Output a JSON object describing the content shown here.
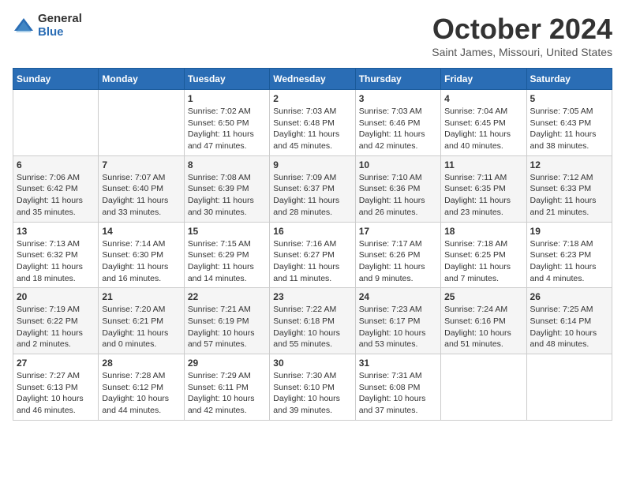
{
  "header": {
    "logo_general": "General",
    "logo_blue": "Blue",
    "month_title": "October 2024",
    "location": "Saint James, Missouri, United States"
  },
  "days_of_week": [
    "Sunday",
    "Monday",
    "Tuesday",
    "Wednesday",
    "Thursday",
    "Friday",
    "Saturday"
  ],
  "weeks": [
    [
      {
        "day": "",
        "sunrise": "",
        "sunset": "",
        "daylight": ""
      },
      {
        "day": "",
        "sunrise": "",
        "sunset": "",
        "daylight": ""
      },
      {
        "day": "1",
        "sunrise": "Sunrise: 7:02 AM",
        "sunset": "Sunset: 6:50 PM",
        "daylight": "Daylight: 11 hours and 47 minutes."
      },
      {
        "day": "2",
        "sunrise": "Sunrise: 7:03 AM",
        "sunset": "Sunset: 6:48 PM",
        "daylight": "Daylight: 11 hours and 45 minutes."
      },
      {
        "day": "3",
        "sunrise": "Sunrise: 7:03 AM",
        "sunset": "Sunset: 6:46 PM",
        "daylight": "Daylight: 11 hours and 42 minutes."
      },
      {
        "day": "4",
        "sunrise": "Sunrise: 7:04 AM",
        "sunset": "Sunset: 6:45 PM",
        "daylight": "Daylight: 11 hours and 40 minutes."
      },
      {
        "day": "5",
        "sunrise": "Sunrise: 7:05 AM",
        "sunset": "Sunset: 6:43 PM",
        "daylight": "Daylight: 11 hours and 38 minutes."
      }
    ],
    [
      {
        "day": "6",
        "sunrise": "Sunrise: 7:06 AM",
        "sunset": "Sunset: 6:42 PM",
        "daylight": "Daylight: 11 hours and 35 minutes."
      },
      {
        "day": "7",
        "sunrise": "Sunrise: 7:07 AM",
        "sunset": "Sunset: 6:40 PM",
        "daylight": "Daylight: 11 hours and 33 minutes."
      },
      {
        "day": "8",
        "sunrise": "Sunrise: 7:08 AM",
        "sunset": "Sunset: 6:39 PM",
        "daylight": "Daylight: 11 hours and 30 minutes."
      },
      {
        "day": "9",
        "sunrise": "Sunrise: 7:09 AM",
        "sunset": "Sunset: 6:37 PM",
        "daylight": "Daylight: 11 hours and 28 minutes."
      },
      {
        "day": "10",
        "sunrise": "Sunrise: 7:10 AM",
        "sunset": "Sunset: 6:36 PM",
        "daylight": "Daylight: 11 hours and 26 minutes."
      },
      {
        "day": "11",
        "sunrise": "Sunrise: 7:11 AM",
        "sunset": "Sunset: 6:35 PM",
        "daylight": "Daylight: 11 hours and 23 minutes."
      },
      {
        "day": "12",
        "sunrise": "Sunrise: 7:12 AM",
        "sunset": "Sunset: 6:33 PM",
        "daylight": "Daylight: 11 hours and 21 minutes."
      }
    ],
    [
      {
        "day": "13",
        "sunrise": "Sunrise: 7:13 AM",
        "sunset": "Sunset: 6:32 PM",
        "daylight": "Daylight: 11 hours and 18 minutes."
      },
      {
        "day": "14",
        "sunrise": "Sunrise: 7:14 AM",
        "sunset": "Sunset: 6:30 PM",
        "daylight": "Daylight: 11 hours and 16 minutes."
      },
      {
        "day": "15",
        "sunrise": "Sunrise: 7:15 AM",
        "sunset": "Sunset: 6:29 PM",
        "daylight": "Daylight: 11 hours and 14 minutes."
      },
      {
        "day": "16",
        "sunrise": "Sunrise: 7:16 AM",
        "sunset": "Sunset: 6:27 PM",
        "daylight": "Daylight: 11 hours and 11 minutes."
      },
      {
        "day": "17",
        "sunrise": "Sunrise: 7:17 AM",
        "sunset": "Sunset: 6:26 PM",
        "daylight": "Daylight: 11 hours and 9 minutes."
      },
      {
        "day": "18",
        "sunrise": "Sunrise: 7:18 AM",
        "sunset": "Sunset: 6:25 PM",
        "daylight": "Daylight: 11 hours and 7 minutes."
      },
      {
        "day": "19",
        "sunrise": "Sunrise: 7:18 AM",
        "sunset": "Sunset: 6:23 PM",
        "daylight": "Daylight: 11 hours and 4 minutes."
      }
    ],
    [
      {
        "day": "20",
        "sunrise": "Sunrise: 7:19 AM",
        "sunset": "Sunset: 6:22 PM",
        "daylight": "Daylight: 11 hours and 2 minutes."
      },
      {
        "day": "21",
        "sunrise": "Sunrise: 7:20 AM",
        "sunset": "Sunset: 6:21 PM",
        "daylight": "Daylight: 11 hours and 0 minutes."
      },
      {
        "day": "22",
        "sunrise": "Sunrise: 7:21 AM",
        "sunset": "Sunset: 6:19 PM",
        "daylight": "Daylight: 10 hours and 57 minutes."
      },
      {
        "day": "23",
        "sunrise": "Sunrise: 7:22 AM",
        "sunset": "Sunset: 6:18 PM",
        "daylight": "Daylight: 10 hours and 55 minutes."
      },
      {
        "day": "24",
        "sunrise": "Sunrise: 7:23 AM",
        "sunset": "Sunset: 6:17 PM",
        "daylight": "Daylight: 10 hours and 53 minutes."
      },
      {
        "day": "25",
        "sunrise": "Sunrise: 7:24 AM",
        "sunset": "Sunset: 6:16 PM",
        "daylight": "Daylight: 10 hours and 51 minutes."
      },
      {
        "day": "26",
        "sunrise": "Sunrise: 7:25 AM",
        "sunset": "Sunset: 6:14 PM",
        "daylight": "Daylight: 10 hours and 48 minutes."
      }
    ],
    [
      {
        "day": "27",
        "sunrise": "Sunrise: 7:27 AM",
        "sunset": "Sunset: 6:13 PM",
        "daylight": "Daylight: 10 hours and 46 minutes."
      },
      {
        "day": "28",
        "sunrise": "Sunrise: 7:28 AM",
        "sunset": "Sunset: 6:12 PM",
        "daylight": "Daylight: 10 hours and 44 minutes."
      },
      {
        "day": "29",
        "sunrise": "Sunrise: 7:29 AM",
        "sunset": "Sunset: 6:11 PM",
        "daylight": "Daylight: 10 hours and 42 minutes."
      },
      {
        "day": "30",
        "sunrise": "Sunrise: 7:30 AM",
        "sunset": "Sunset: 6:10 PM",
        "daylight": "Daylight: 10 hours and 39 minutes."
      },
      {
        "day": "31",
        "sunrise": "Sunrise: 7:31 AM",
        "sunset": "Sunset: 6:08 PM",
        "daylight": "Daylight: 10 hours and 37 minutes."
      },
      {
        "day": "",
        "sunrise": "",
        "sunset": "",
        "daylight": ""
      },
      {
        "day": "",
        "sunrise": "",
        "sunset": "",
        "daylight": ""
      }
    ]
  ]
}
